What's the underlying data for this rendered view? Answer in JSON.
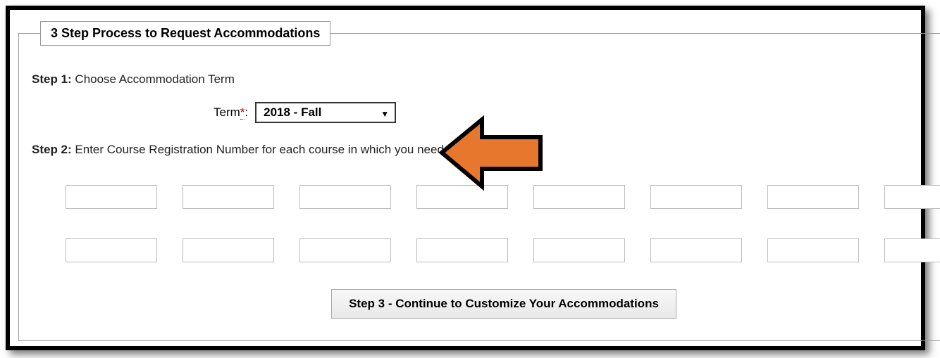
{
  "fieldset_title": "3 Step Process to Request Accommodations",
  "step1": {
    "label_prefix": "Step 1:",
    "label_text": " Choose Accommodation Term",
    "term_label": "Term",
    "required_mark": "*",
    "colon": ":",
    "term_selected": "2018 - Fall"
  },
  "step2": {
    "label_prefix": "Step 2:",
    "label_text": " Enter Course Registration Number for each course in which you need accommodation",
    "inputs": [
      "",
      "",
      "",
      "",
      "",
      "",
      "",
      "",
      "",
      "",
      "",
      "",
      "",
      "",
      "",
      ""
    ]
  },
  "step3": {
    "button_label": "Step 3 - Continue to Customize Your Accommodations"
  }
}
